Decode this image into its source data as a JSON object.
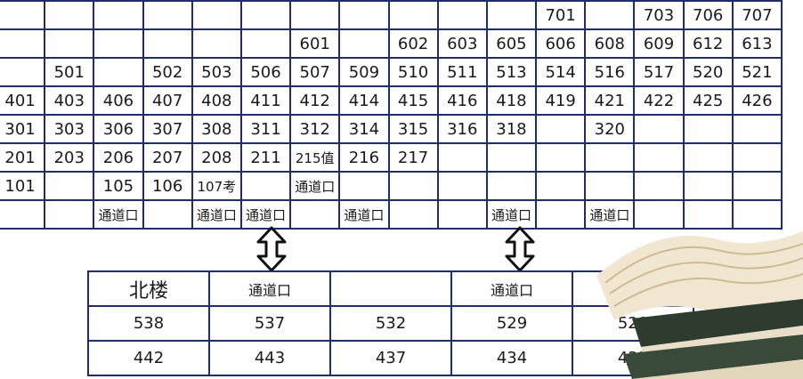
{
  "top_rows": [
    [
      "",
      "",
      "",
      "",
      "",
      "",
      "",
      "",
      "",
      "",
      "",
      "701",
      "",
      "703",
      "706",
      "707"
    ],
    [
      "",
      "",
      "",
      "",
      "",
      "",
      "601",
      "",
      "602",
      "603",
      "605",
      "606",
      "608",
      "609",
      "612",
      "613"
    ],
    [
      "",
      "501",
      "",
      "502",
      "503",
      "506",
      "507",
      "509",
      "510",
      "511",
      "513",
      "514",
      "516",
      "517",
      "520",
      "521"
    ],
    [
      "401",
      "403",
      "406",
      "407",
      "408",
      "411",
      "412",
      "414",
      "415",
      "416",
      "418",
      "419",
      "421",
      "422",
      "425",
      "426"
    ],
    [
      "301",
      "303",
      "306",
      "307",
      "308",
      "311",
      "312",
      "314",
      "315",
      "316",
      "318",
      "",
      "320",
      "",
      "",
      ""
    ],
    [
      "201",
      "203",
      "206",
      "207",
      "208",
      "211",
      "215值",
      "216",
      "217",
      "",
      "",
      "",
      "",
      "",
      "",
      ""
    ],
    [
      "101",
      "",
      "105",
      "106",
      "107考",
      "",
      "通道口",
      "",
      "",
      "",
      "",
      "",
      "",
      "",
      "",
      ""
    ],
    [
      "",
      "",
      "通道口",
      "",
      "通道口",
      "通道口",
      "",
      "通道口",
      "",
      "",
      "通道口",
      "",
      "通道口",
      "",
      "",
      ""
    ]
  ],
  "bottom_rows": [
    [
      "北楼",
      "通道口",
      "",
      "通道口",
      ""
    ],
    [
      "538",
      "537",
      "532",
      "529",
      "528"
    ],
    [
      "442",
      "443",
      "437",
      "434",
      "433"
    ]
  ],
  "colors": {
    "grid_line": "#1f2d6a",
    "arrow": "#111111"
  },
  "icons": [
    "double-arrow-icon",
    "books-illustration"
  ]
}
